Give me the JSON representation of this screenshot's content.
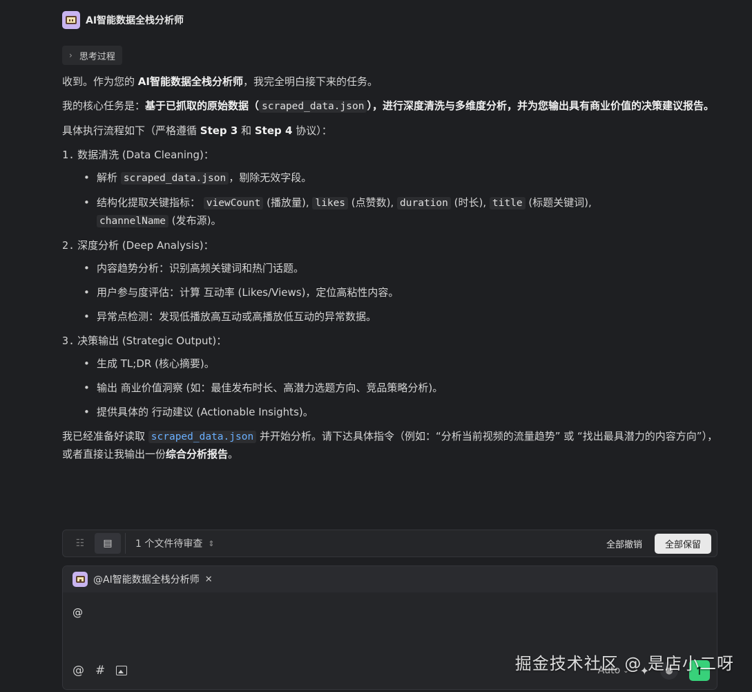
{
  "header": {
    "title": "AI智能数据全栈分析师",
    "avatar_icon": "robot-avatar-icon"
  },
  "think": {
    "label": "思考过程"
  },
  "message": {
    "intro_a": "收到。作为您的 ",
    "intro_b": "AI智能数据全栈分析师",
    "intro_c": "，我完全明白接下来的任务。",
    "task_a": "我的核心任务是：",
    "task_b": "基于已抓取的原始数据（",
    "task_code": "scraped_data.json",
    "task_c": "），进行深度清洗与多维度分析，并为您输出具有商业价值的决策建议报告。",
    "flow_a": "具体执行流程如下（严格遵循 ",
    "flow_step3": "Step 3",
    "flow_and": " 和 ",
    "flow_step4": "Step 4",
    "flow_b": " 协议）：",
    "s1_num": "1.",
    "s1_title": "数据清洗 (Data Cleaning)：",
    "s1_b1_a": "解析 ",
    "s1_b1_code": "scraped_data.json",
    "s1_b1_b": "，剔除无效字段。",
    "s1_b2_a": "结构化提取关键指标： ",
    "s1_b2_c1": "viewCount",
    "s1_b2_t1": " (播放量), ",
    "s1_b2_c2": "likes",
    "s1_b2_t2": " (点赞数), ",
    "s1_b2_c3": "duration",
    "s1_b2_t3": " (时长), ",
    "s1_b2_c4": "title",
    "s1_b2_t4": " (标题关键词),",
    "s1_b2_c5": "channelName",
    "s1_b2_t5": " (发布源)。",
    "s2_num": "2.",
    "s2_title": "深度分析 (Deep Analysis)：",
    "s2_b1": "内容趋势分析：识别高频关键词和热门话题。",
    "s2_b2": "用户参与度评估：计算 互动率 (Likes/Views)，定位高粘性内容。",
    "s2_b3": "异常点检测：发现低播放高互动或高播放低互动的异常数据。",
    "s3_num": "3.",
    "s3_title": "决策输出 (Strategic Output)：",
    "s3_b1": "生成 TL;DR (核心摘要)。",
    "s3_b2": "输出 商业价值洞察 (如：最佳发布时长、高潜力选题方向、竞品策略分析)。",
    "s3_b3": "提供具体的 行动建议 (Actionable Insights)。",
    "end_a": "我已经准备好读取 ",
    "end_code": "scraped_data.json",
    "end_b": " 并开始分析。请下达具体指令（例如：“分析当前视频的流量趋势” 或 “找出最具潜力的内容方向”），或者直接让我输出一份",
    "end_bold": "综合分析报告",
    "end_c": "。"
  },
  "review_bar": {
    "files_label": "1 个文件待审查",
    "reject_all": "全部撤销",
    "keep_all": "全部保留"
  },
  "composer": {
    "agent_label": "@AI智能数据全栈分析师",
    "input_value": "@",
    "at_symbol": "@",
    "hash_symbol": "#",
    "model": "Auto"
  },
  "watermark": "掘金技术社区 @ 是店小二呀",
  "colors": {
    "accent_send": "#38d17a",
    "code_link": "#6ab0ff",
    "background": "#1e1f22"
  }
}
